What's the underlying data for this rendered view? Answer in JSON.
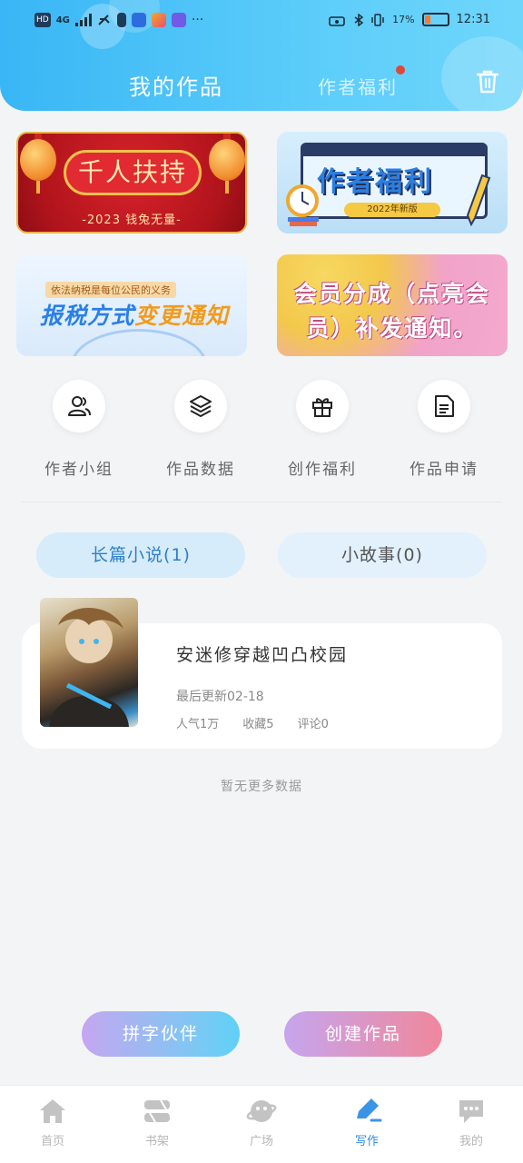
{
  "status_bar": {
    "left_badges": [
      "HD",
      "4G"
    ],
    "battery_percent": "17%",
    "time": "12:31"
  },
  "header": {
    "tab_main": "我的作品",
    "tab_benefit": "作者福利"
  },
  "banners": [
    {
      "title": "千人扶持",
      "subtitle": "-2023 钱兔无量-"
    },
    {
      "title": "作者福利",
      "subtitle": "2022年新版"
    },
    {
      "tag": "依法纳税是每位公民的义务",
      "title_a": "报税方式",
      "title_b": "变更通知"
    },
    {
      "line1": "会员分成（点亮会",
      "line2": "员）补发通知。"
    }
  ],
  "shortcuts": [
    {
      "label": "作者小组",
      "icon": "group-icon"
    },
    {
      "label": "作品数据",
      "icon": "layers-icon"
    },
    {
      "label": "创作福利",
      "icon": "gift-icon"
    },
    {
      "label": "作品申请",
      "icon": "document-icon"
    }
  ],
  "categories": {
    "long": "长篇小说(1)",
    "short": "小故事(0)"
  },
  "work": {
    "title": "安迷修穿越凹凸校园",
    "updated": "最后更新02-18",
    "popularity": "人气1万",
    "favorites": "收藏5",
    "comments": "评论0"
  },
  "no_more": "暂无更多数据",
  "buttons": {
    "partner": "拼字伙伴",
    "create": "创建作品"
  },
  "bottom_nav": [
    {
      "label": "首页",
      "icon": "home-icon"
    },
    {
      "label": "书架",
      "icon": "bookshelf-icon"
    },
    {
      "label": "广场",
      "icon": "planet-icon"
    },
    {
      "label": "写作",
      "icon": "pen-icon",
      "active": true
    },
    {
      "label": "我的",
      "icon": "chat-icon"
    }
  ],
  "colors": {
    "header": "#39b6f5",
    "accent": "#2f8fe0",
    "red_dot": "#e0463a"
  }
}
